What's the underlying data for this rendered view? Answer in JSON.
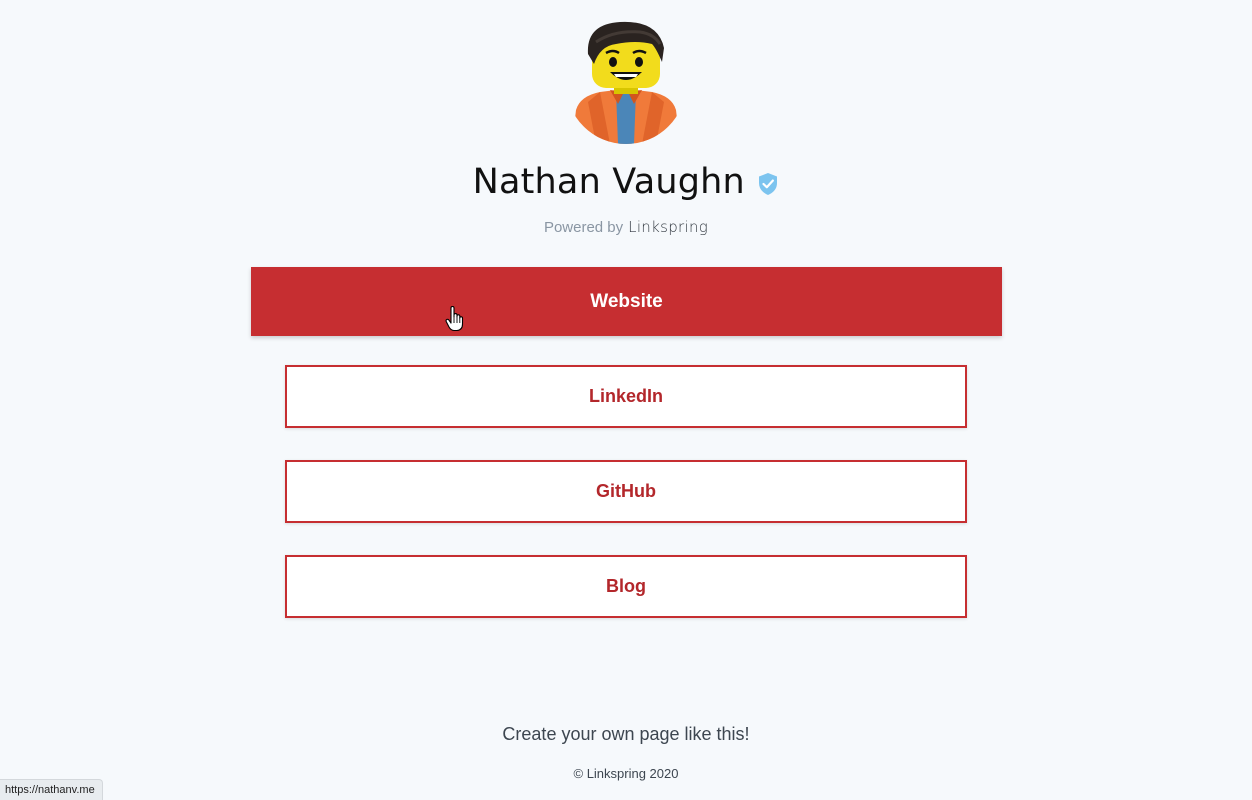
{
  "profile": {
    "name": "Nathan Vaughn",
    "verified_icon": "verified-badge-icon",
    "avatar_icon": "lego-minifigure-avatar"
  },
  "powered": {
    "prefix": "Powered by",
    "brand": "Linkspring"
  },
  "links": [
    {
      "label": "Website",
      "style": "primary"
    },
    {
      "label": "LinkedIn",
      "style": "outline"
    },
    {
      "label": "GitHub",
      "style": "outline"
    },
    {
      "label": "Blog",
      "style": "outline"
    }
  ],
  "footer": {
    "cta": "Create your own page like this!",
    "copyright": "© Linkspring 2020"
  },
  "status_bar": {
    "url": "https://nathanv.me"
  },
  "colors": {
    "accent": "#c62e31",
    "background": "#f6f9fc",
    "verified": "#7cc4ef"
  }
}
